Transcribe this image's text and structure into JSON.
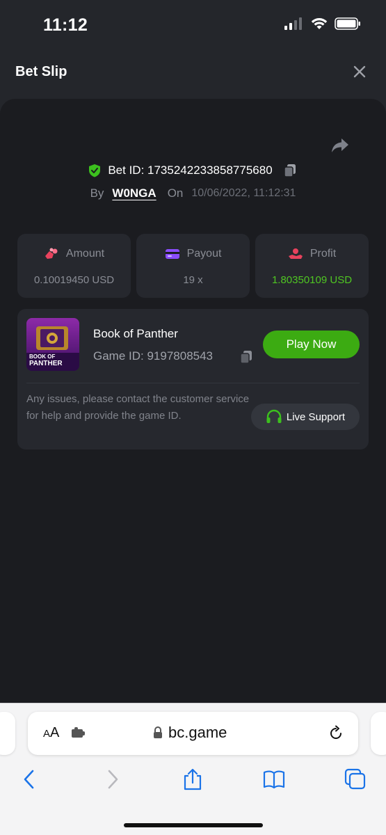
{
  "status": {
    "time": "11:12"
  },
  "header": {
    "title": "Bet Slip"
  },
  "bet": {
    "id_label": "Bet ID: 1735242233858775680",
    "by_label": "By",
    "user": "W0NGA",
    "on_label": "On",
    "datetime": "10/06/2022, 11:12:31"
  },
  "stats": [
    {
      "label": "Amount",
      "value": "0.10019450 USD",
      "icon": "coins-icon"
    },
    {
      "label": "Payout",
      "value": "19 x",
      "icon": "card-icon"
    },
    {
      "label": "Profit",
      "value": "1.80350109 USD",
      "icon": "profit-icon"
    }
  ],
  "game": {
    "title": "Book of Panther",
    "id_label": "Game ID: 9197808543",
    "thumb_text_1": "BOOK OF",
    "thumb_text_2": "PANTHER",
    "play_label": "Play Now",
    "issue_text": "Any issues, please contact the customer service for help and provide the game ID.",
    "support_label": "Live Support"
  },
  "browser": {
    "aa_label_small": "A",
    "aa_label": "A",
    "url": "bc.game"
  },
  "colors": {
    "accent_green": "#3cab12",
    "profit_green": "#4fc622",
    "panel": "#1b1c20",
    "card": "#26282e"
  }
}
